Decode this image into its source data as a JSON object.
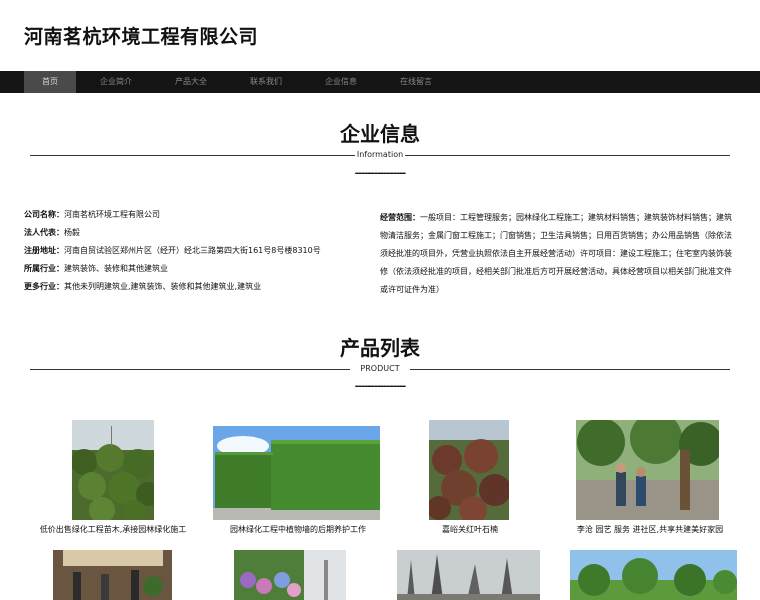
{
  "site": {
    "title": "河南茗杭环境工程有限公司"
  },
  "nav": [
    {
      "label": "首页",
      "active": true
    },
    {
      "label": "企业简介"
    },
    {
      "label": "产品大全"
    },
    {
      "label": "联系我们"
    },
    {
      "label": "企业信息"
    },
    {
      "label": "在线留言"
    }
  ],
  "company_info": {
    "heading": "企业信息",
    "subtitle": "Information",
    "dashes": "----------------",
    "rows": [
      {
        "label": "公司名称：",
        "value": "河南茗杭环境工程有限公司"
      },
      {
        "label": "法人代表：",
        "value": "杨毅"
      },
      {
        "label": "注册地址：",
        "value": "河南自贸试验区郑州片区（经开）经北三路第四大街161号8号楼8310号"
      },
      {
        "label": "所属行业：",
        "value": "建筑装饰、装修和其他建筑业"
      },
      {
        "label": "更多行业：",
        "value": "其他未列明建筑业,建筑装饰、装修和其他建筑业,建筑业"
      }
    ],
    "scope_label": "经营范围：",
    "scope_text": "一般项目：工程管理服务；园林绿化工程施工；建筑材料销售；建筑装饰材料销售；建筑物清洁服务；金属门窗工程施工；门窗销售；卫生洁具销售；日用百货销售；办公用品销售（除依法须经批准的项目外，凭营业执照依法自主开展经营活动）许可项目：建设工程施工；住宅室内装饰装修（依法须经批准的项目，经相关部门批准后方可开展经营活动，具体经营项目以相关部门批准文件或许可证件为准）"
  },
  "products": {
    "heading": "产品列表",
    "subtitle": "PRODUCT",
    "dashes": "----------------",
    "items": [
      {
        "caption": "低价出售绿化工程苗木,承接园林绿化施工"
      },
      {
        "caption": "园林绿化工程中植物墙的后期养护工作"
      },
      {
        "caption": "嘉峪关红叶石楠"
      },
      {
        "caption": "李沧 园艺 服务 进社区,共享共建美好家园"
      },
      {
        "caption": ""
      },
      {
        "caption": ""
      },
      {
        "caption": ""
      },
      {
        "caption": ""
      }
    ]
  },
  "colors": {
    "navbar_bg": "#141414",
    "nav_active_bg": "#4a4a4a",
    "nav_text": "#888888",
    "text": "#111111"
  }
}
